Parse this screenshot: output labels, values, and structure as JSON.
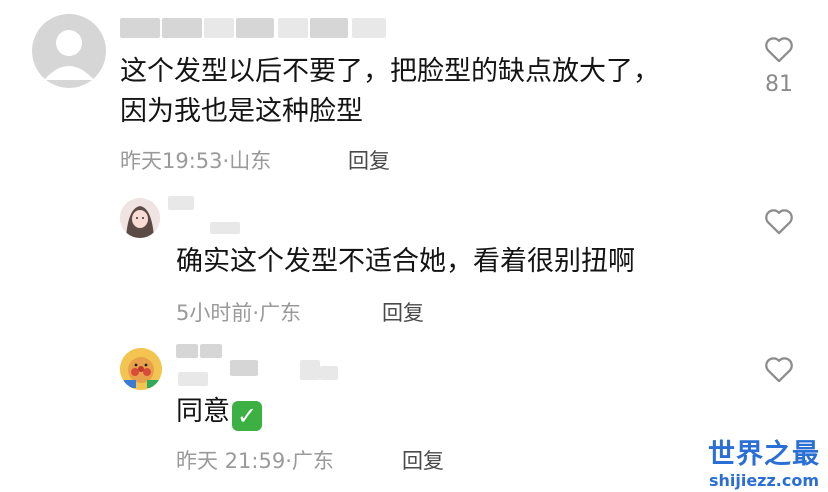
{
  "comments": [
    {
      "avatar_icon": "default-user-icon",
      "text_line1": "这个发型以后不要了，把脸型的缺点放大了，",
      "text_line2": "因为我也是这种脸型",
      "time": "昨天19:53",
      "location": "山东",
      "reply_label": "回复",
      "like_icon": "heart-outline-icon",
      "like_count": "81"
    },
    {
      "avatar_icon": "user-photo-icon",
      "text": "确实这个发型不适合她，看着很别扭啊",
      "time": "5小时前",
      "location": "广东",
      "reply_label": "回复",
      "like_icon": "heart-outline-icon"
    },
    {
      "avatar_icon": "cartoon-avatar-icon",
      "text": "同意",
      "emoji": "✅",
      "time": "昨天 21:59",
      "location": "广东",
      "reply_label": "回复",
      "like_icon": "heart-outline-icon"
    }
  ],
  "meta_separator": "·",
  "watermark": {
    "title": "世界之最",
    "url": "shijiezz.com"
  },
  "colors": {
    "text": "#141414",
    "meta": "#9a9a9a",
    "watermark": "#2a6fd6"
  }
}
